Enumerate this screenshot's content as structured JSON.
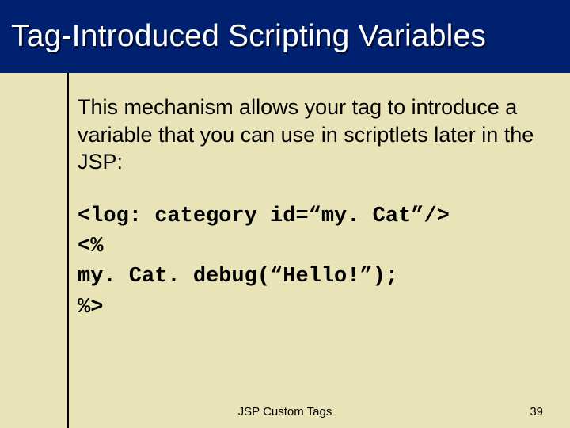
{
  "title": "Tag-Introduced Scripting Variables",
  "paragraph": "This mechanism allows your tag to introduce a variable that you can use in scriptlets later in the JSP:",
  "code": {
    "line1": "<log: category id=“my. Cat”/>",
    "line2": "<%",
    "line3": "my. Cat. debug(“Hello!”);",
    "line4": "%>"
  },
  "footer": {
    "center": "JSP Custom Tags",
    "page_number": "39"
  }
}
